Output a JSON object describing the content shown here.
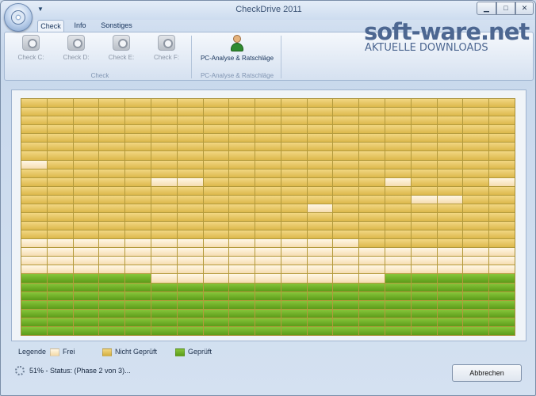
{
  "window": {
    "title": "CheckDrive 2011"
  },
  "tabs": [
    {
      "label": "Check",
      "active": true
    },
    {
      "label": "Info",
      "active": false
    },
    {
      "label": "Sonstiges",
      "active": false
    }
  ],
  "ribbon": {
    "check_buttons": [
      {
        "label": "Check C:",
        "icon": "drive-check-icon"
      },
      {
        "label": "Check D:",
        "icon": "drive-check-icon"
      },
      {
        "label": "Check E:",
        "icon": "drive-check-icon"
      },
      {
        "label": "Check F:",
        "icon": "drive-check-icon"
      }
    ],
    "check_group_label": "Check",
    "pc_button_label": "PC-Analyse & Ratschläge",
    "pc_group_label": "PC-Analyse & Ratschläge"
  },
  "watermark": {
    "main": "soft-ware.net",
    "sub": "AKTUELLE DOWNLOADS"
  },
  "grid": {
    "columns": 19,
    "rows": [
      "nnnnnnnnnnnnnnnnnnn",
      "nnnnnnnnnnnnnnnnnnn",
      "nnnnnnnnnnnnnnnnnnn",
      "nnnnnnnnnnnnnnnnnnn",
      "nnnnnnnnnnnnnnnnnnn",
      "nnnnnnnnnnnnnnnnnnn",
      "nnnnnnnnnnnnnnnnnnn",
      "fnnnnnnnnnnnnnnnnnn",
      "nnnnnnnnnnnnnnnnnnn",
      "nnnnnffnnnnnnnfnnnf",
      "nnnnnnnnnnnnnnnnnnn",
      "nnnnnnnnnnnnnnnffnn",
      "nnnnnnnnnnnfnnnnnnn",
      "nnnnnnnnnnnnnnnnnnn",
      "nnnnnnnnnnnnnnnnnnn",
      "nnnnnnnnnnnnnnnnnnn",
      "fffffffffffffnnnnnn",
      "fffffffffffffffffff",
      "fffffffffffffffffff",
      "fffffffffffffffffff",
      "gggggfffffffffggggg",
      "ggggggggggggggggggg",
      "ggggggggggggggggggg",
      "ggggggggggggggggggg",
      "ggggggggggggggggggg",
      "ggggggggggggggggggg",
      "ggggggggggggggggggg"
    ]
  },
  "legend": {
    "title": "Legende",
    "items": [
      {
        "label": "Frei",
        "color": "#f8e4bf"
      },
      {
        "label": "Nicht Geprüft",
        "color": "#e4c25a"
      },
      {
        "label": "Geprüft",
        "color": "#6fb02a"
      }
    ]
  },
  "status": {
    "text": "51% - Status: (Phase 2 von 3)..."
  },
  "cancel_label": "Abbrechen"
}
